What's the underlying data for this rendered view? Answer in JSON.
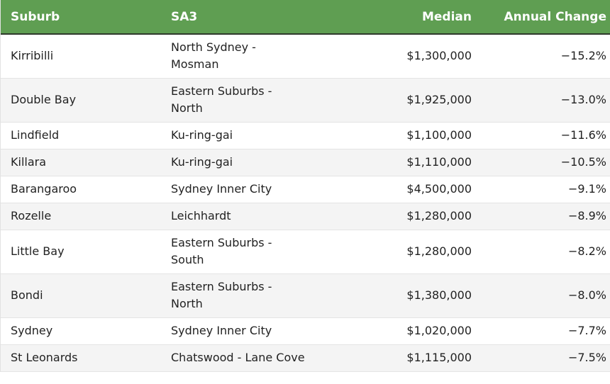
{
  "table": {
    "headers": {
      "suburb": "Suburb",
      "sa3": "SA3",
      "median": "Median",
      "change": "Annual Change"
    },
    "rows": [
      {
        "suburb": "Kirribilli",
        "sa3": "North Sydney - Mosman",
        "median": "$1,300,000",
        "change": "−15.2%"
      },
      {
        "suburb": "Double Bay",
        "sa3": "Eastern Suburbs - North",
        "median": "$1,925,000",
        "change": "−13.0%"
      },
      {
        "suburb": "Lindfield",
        "sa3": "Ku-ring-gai",
        "median": "$1,100,000",
        "change": "−11.6%"
      },
      {
        "suburb": "Killara",
        "sa3": "Ku-ring-gai",
        "median": "$1,110,000",
        "change": "−10.5%"
      },
      {
        "suburb": "Barangaroo",
        "sa3": "Sydney Inner City",
        "median": "$4,500,000",
        "change": "−9.1%"
      },
      {
        "suburb": "Rozelle",
        "sa3": "Leichhardt",
        "median": "$1,280,000",
        "change": "−8.9%"
      },
      {
        "suburb": "Little Bay",
        "sa3": "Eastern Suburbs - South",
        "median": "$1,280,000",
        "change": "−8.2%"
      },
      {
        "suburb": "Bondi",
        "sa3": "Eastern Suburbs - North",
        "median": "$1,380,000",
        "change": "−8.0%"
      },
      {
        "suburb": "Sydney",
        "sa3": "Sydney Inner City",
        "median": "$1,020,000",
        "change": "−7.7%"
      },
      {
        "suburb": "St Leonards",
        "sa3": "Chatswood - Lane Cove",
        "median": "$1,115,000",
        "change": "−7.5%"
      }
    ]
  },
  "colors": {
    "header_bg": "#5f9e52",
    "header_text": "#ffffff",
    "row_alt_bg": "#f4f4f4"
  }
}
